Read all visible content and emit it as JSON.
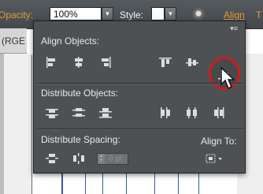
{
  "topbar": {
    "opacity_label": "Opacity:",
    "opacity_value": "100%",
    "style_label": "Style:",
    "align_link": "Align",
    "extra_label": "T"
  },
  "document": {
    "tab_label": "(RGE"
  },
  "panel": {
    "align_objects_title": "Align Objects:",
    "distribute_objects_title": "Distribute Objects:",
    "distribute_spacing_title": "Distribute Spacing:",
    "align_to_label": "Align To:",
    "spacing_value": "0 pt"
  },
  "colors": {
    "panel_bg": "#4d5154",
    "accent_orange": "#e39a38",
    "highlight_red": "#d11a1a"
  }
}
